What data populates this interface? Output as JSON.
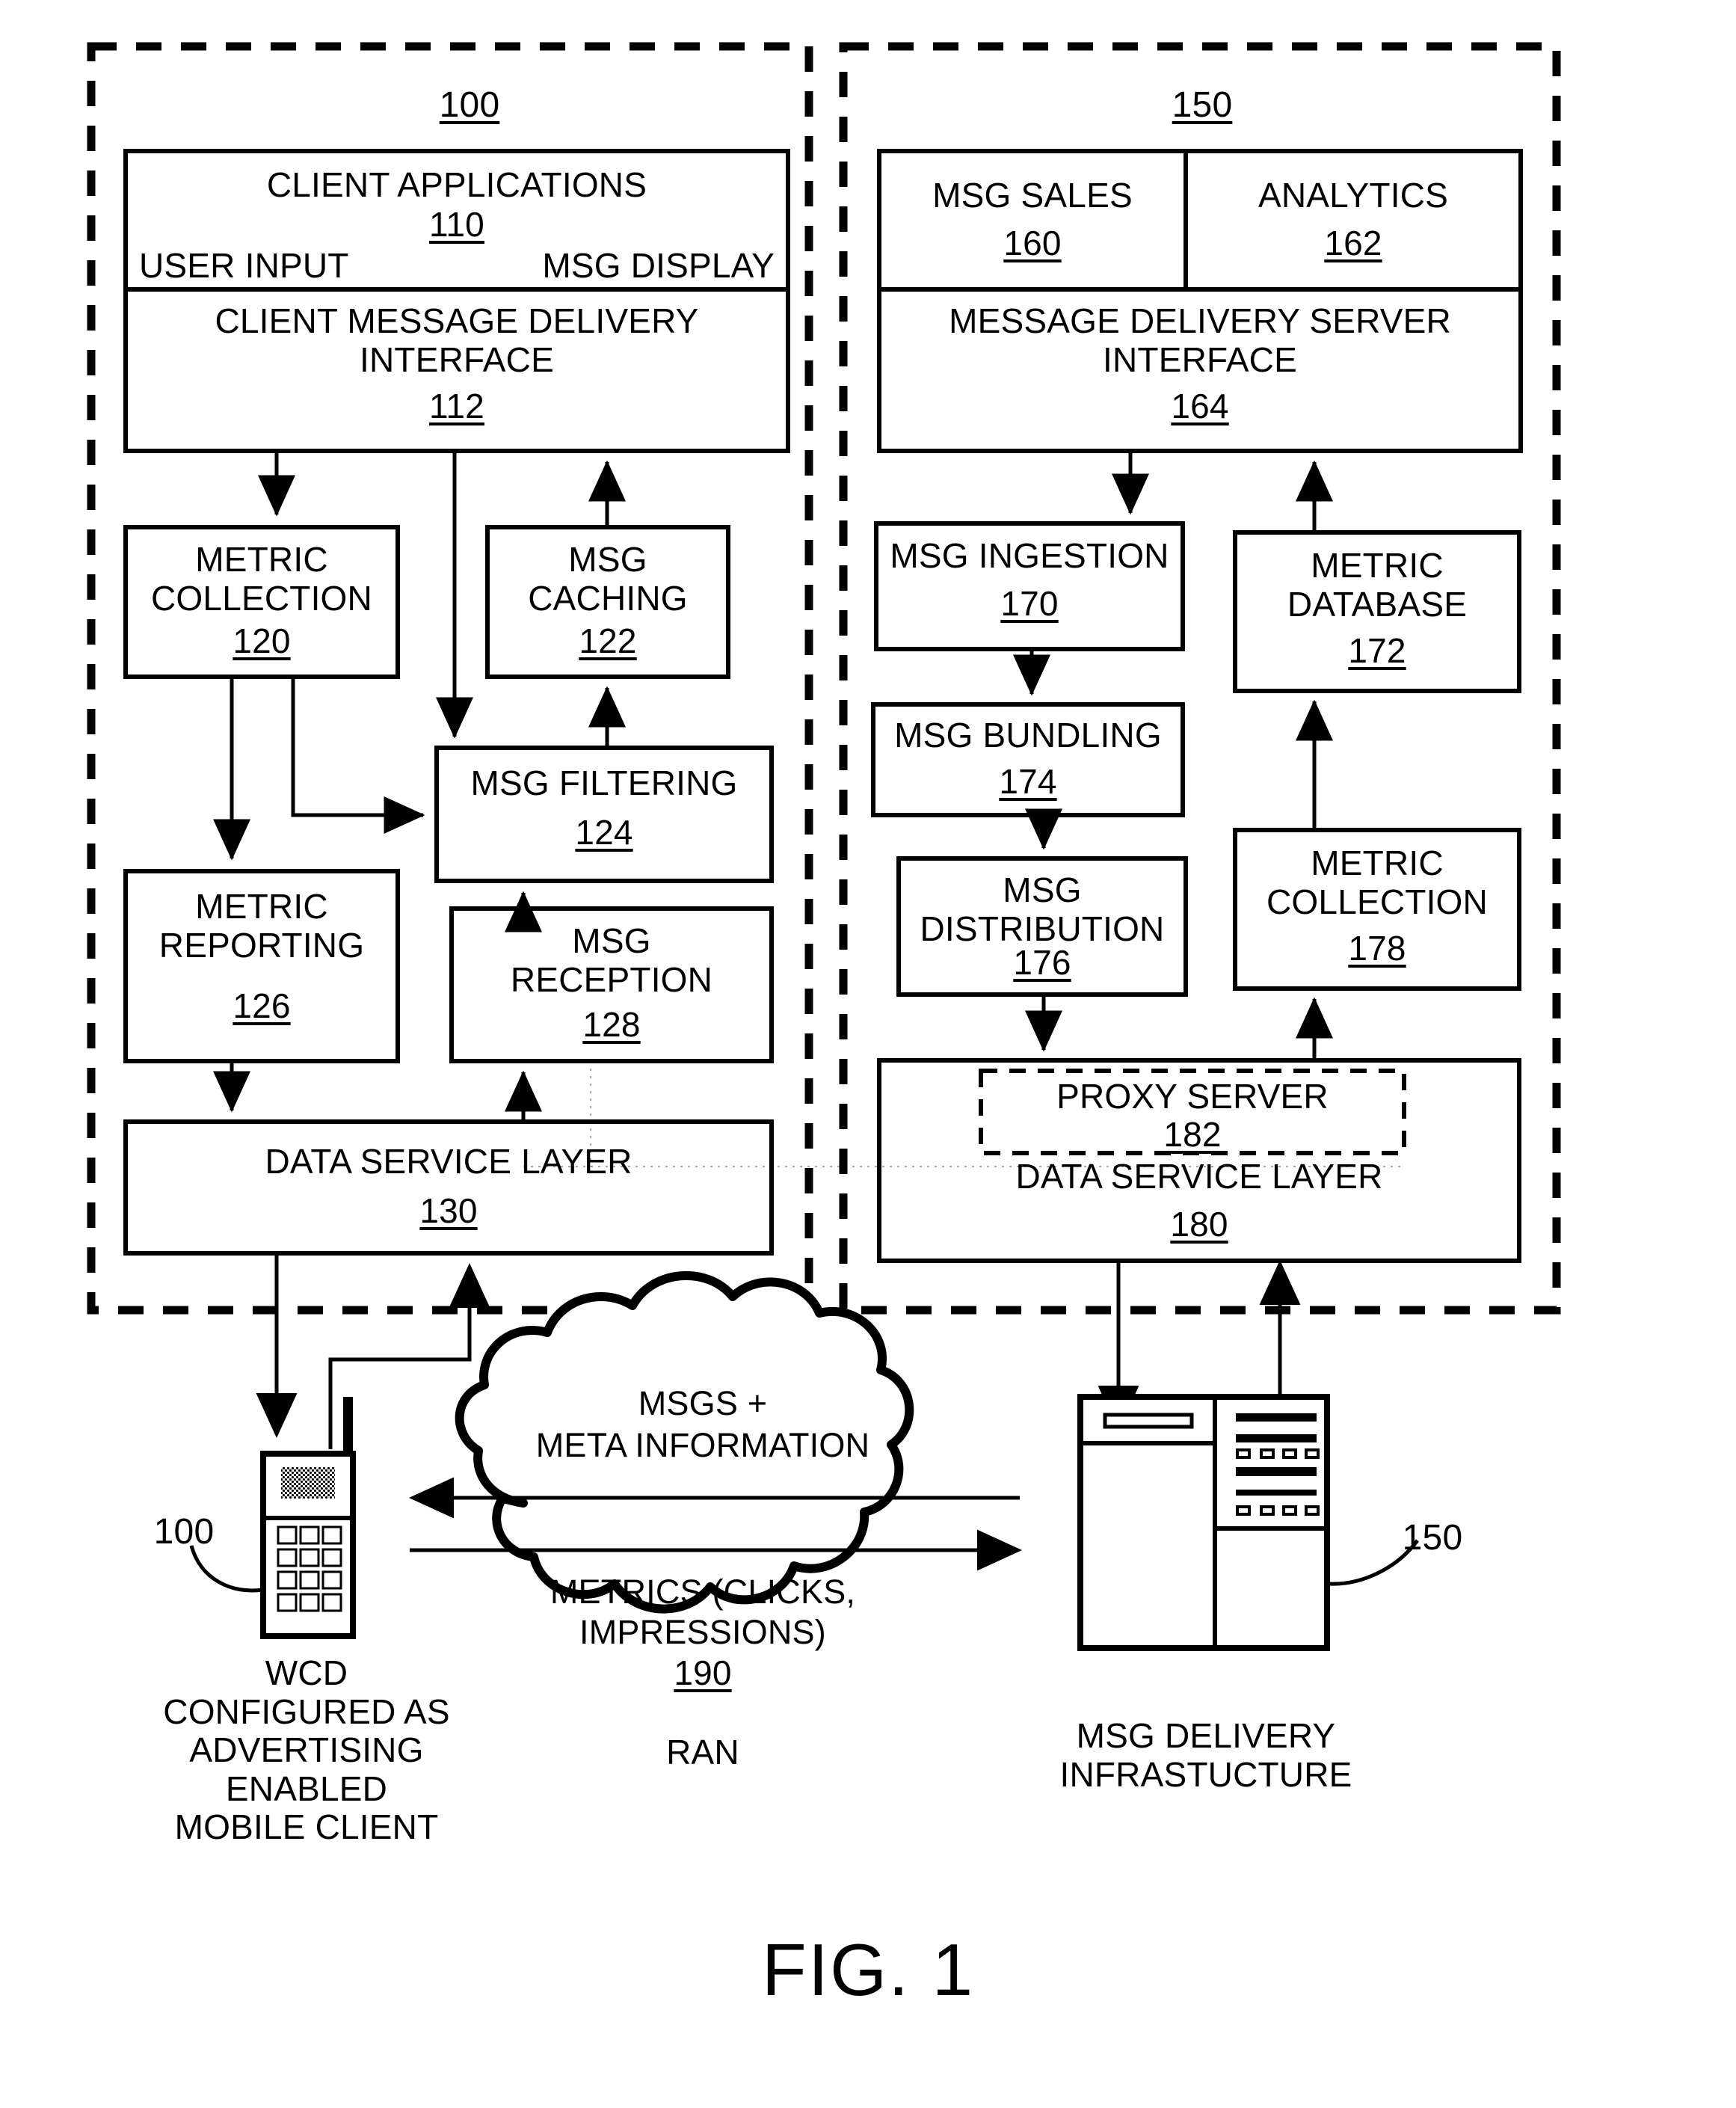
{
  "figure": {
    "title": "FIG. 1",
    "left_panel_ref": "100",
    "right_panel_ref": "150"
  },
  "client_panel": {
    "ref": "100",
    "client_applications": {
      "title": "CLIENT APPLICATIONS",
      "ref": "110",
      "user_input": "USER INPUT",
      "msg_display": "MSG DISPLAY"
    },
    "client_message_delivery_interface": {
      "title": "CLIENT MESSAGE DELIVERY\nINTERFACE",
      "ref": "112"
    },
    "metric_collection": {
      "title": "METRIC\nCOLLECTION",
      "ref": "120"
    },
    "msg_caching": {
      "title": "MSG\nCACHING",
      "ref": "122"
    },
    "msg_filtering": {
      "title": "MSG FILTERING",
      "ref": "124"
    },
    "metric_reporting": {
      "title": "METRIC\nREPORTING",
      "ref": "126"
    },
    "msg_reception": {
      "title": "MSG\nRECEPTION",
      "ref": "128"
    },
    "data_service_layer": {
      "title": "DATA SERVICE LAYER",
      "ref": "130"
    }
  },
  "server_panel": {
    "ref": "150",
    "msg_sales": {
      "title": "MSG SALES",
      "ref": "160"
    },
    "analytics": {
      "title": "ANALYTICS",
      "ref": "162"
    },
    "message_delivery_server_interface": {
      "title": "MESSAGE DELIVERY SERVER\nINTERFACE",
      "ref": "164"
    },
    "msg_ingestion": {
      "title": "MSG INGESTION",
      "ref": "170"
    },
    "metric_database": {
      "title": "METRIC\nDATABASE",
      "ref": "172"
    },
    "msg_bundling": {
      "title": "MSG BUNDLING",
      "ref": "174"
    },
    "msg_distribution": {
      "title": "MSG\nDISTRIBUTION",
      "ref": "176"
    },
    "metric_collection": {
      "title": "METRIC\nCOLLECTION",
      "ref": "178"
    },
    "proxy_server": {
      "title": "PROXY SERVER",
      "ref": "182"
    },
    "data_service_layer": {
      "title": "DATA SERVICE LAYER",
      "ref": "180"
    }
  },
  "network": {
    "cloud_line1": "MSGS +",
    "cloud_line2": "META INFORMATION",
    "cloud_line3": "METRICS (CLICKS,",
    "cloud_line4": "IMPRESSIONS)",
    "cloud_ref": "190",
    "cloud_name": "RAN"
  },
  "devices": {
    "wcd_lead": "100",
    "wcd_caption": "WCD\nCONFIGURED AS\nADVERTISING\nENABLED\nMOBILE CLIENT",
    "server_lead": "150",
    "server_caption": "MSG DELIVERY\nINFRASTUCTURE"
  },
  "colors": {
    "ink": "#000000",
    "paper": "#ffffff",
    "screen_fill": "#8a8a8a"
  }
}
